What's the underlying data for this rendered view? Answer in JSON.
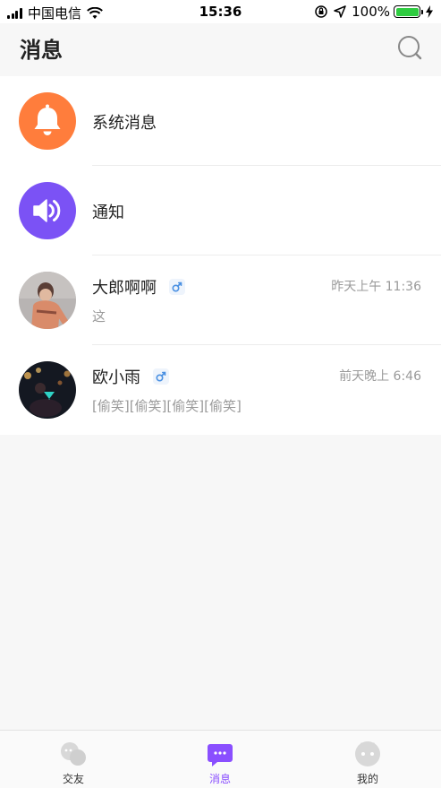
{
  "status_bar": {
    "carrier": "中国电信",
    "time": "15:36",
    "battery": "100%",
    "battery_level": 1.0
  },
  "header": {
    "title": "消息",
    "search_icon": "search-icon"
  },
  "messages": [
    {
      "title": "系统消息",
      "icon": "bell-icon",
      "color": "#ff7d3c"
    },
    {
      "title": "通知",
      "icon": "speaker-icon",
      "color": "#7b52f5"
    },
    {
      "title": "大郎啊啊",
      "gender_icon": "male-icon",
      "time": "昨天上午 11:36",
      "preview": "这"
    },
    {
      "title": "欧小雨",
      "gender_icon": "male-icon",
      "time": "前天晚上 6:46",
      "preview": "[偷笑][偷笑][偷笑][偷笑]"
    }
  ],
  "tabs": [
    {
      "label": "交友",
      "icon": "chat-bubbles-icon",
      "active": false
    },
    {
      "label": "消息",
      "icon": "message-icon",
      "active": true
    },
    {
      "label": "我的",
      "icon": "profile-face-icon",
      "active": false
    }
  ],
  "colors": {
    "accent": "#8a4fff",
    "system_orange": "#ff7d3c",
    "notice_purple": "#7b52f5",
    "male_blue": "#4a90e2"
  }
}
